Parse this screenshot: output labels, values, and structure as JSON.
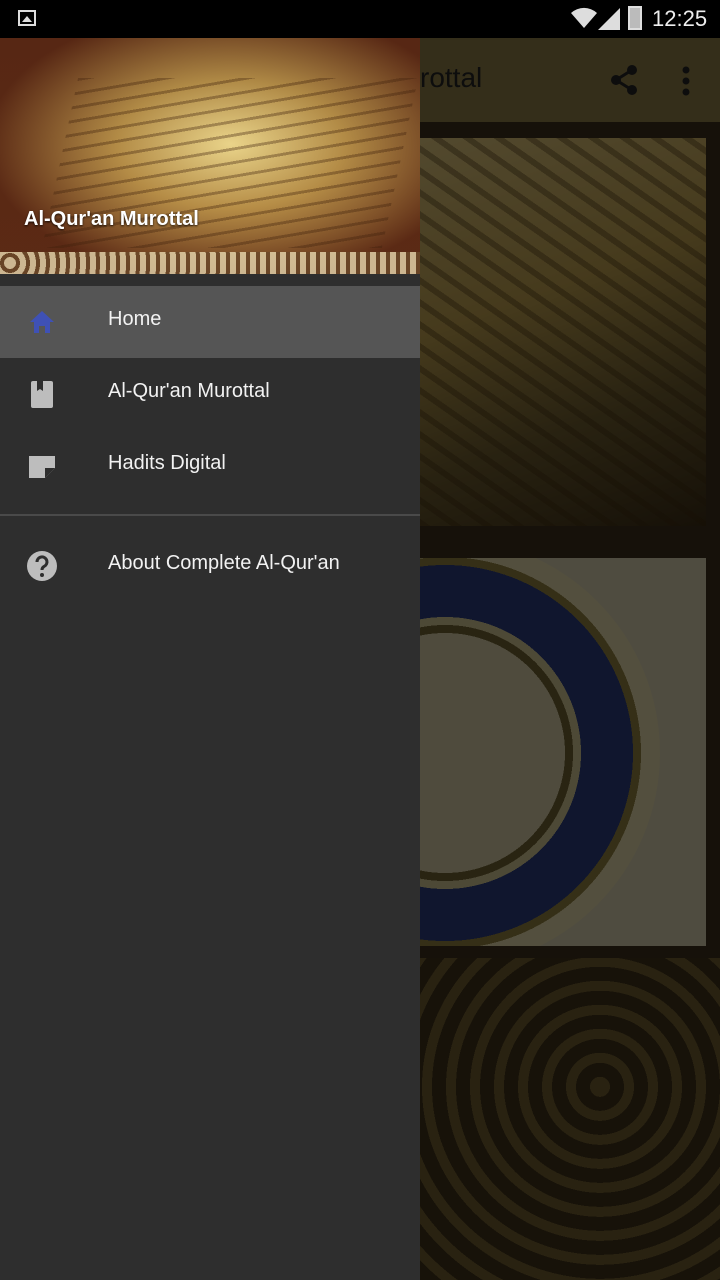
{
  "status_bar": {
    "time": "12:25"
  },
  "app": {
    "toolbar_title": "Al-Qur'an Murottal",
    "toolbar_title_visible": "rottal"
  },
  "drawer": {
    "header_title": "Al-Qur'an Murottal",
    "items": [
      {
        "label": "Home",
        "icon": "home-icon",
        "active": true
      },
      {
        "label": "Al-Qur'an Murottal",
        "icon": "book-icon",
        "active": false
      },
      {
        "label": "Hadits Digital",
        "icon": "note-icon",
        "active": false
      }
    ],
    "secondary_items": [
      {
        "label": "About Complete Al-Qur'an",
        "icon": "help-icon"
      }
    ]
  },
  "colors": {
    "accent": "#3f51b5",
    "drawer_bg": "#2e2e2e",
    "active_bg": "#555555"
  }
}
